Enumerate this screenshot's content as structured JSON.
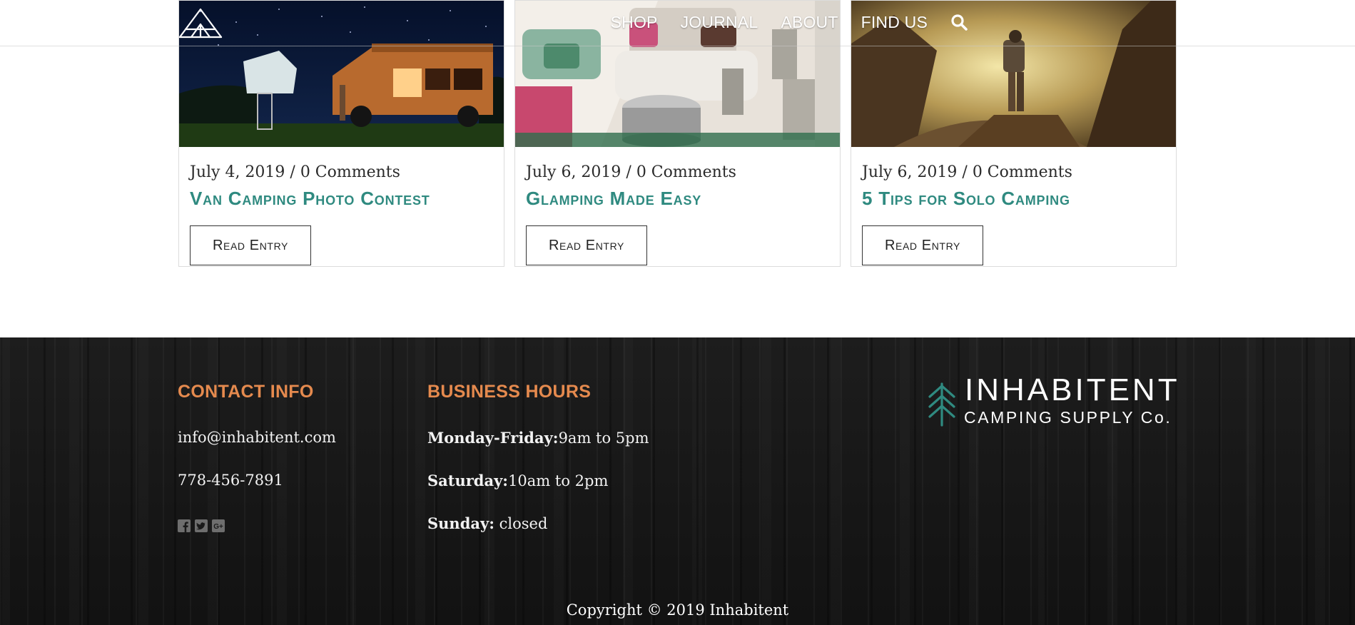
{
  "header": {
    "logo_icon": "tent-logo-icon",
    "nav": [
      "SHOP",
      "JOURNAL",
      "ABOUT",
      "FIND US"
    ],
    "search_icon": "search-icon"
  },
  "posts": [
    {
      "meta": "July 4, 2019 / 0 Comments",
      "title": "Van Camping Photo Contest",
      "button": "Read Entry",
      "image": "van-camping-night-photo"
    },
    {
      "meta": "July 6, 2019 / 0 Comments",
      "title": "Glamping Made Easy",
      "button": "Read Entry",
      "image": "glamping-tent-interior-photo"
    },
    {
      "meta": "July 6, 2019 / 0 Comments",
      "title": "5 Tips for Solo Camping",
      "button": "Read Entry",
      "image": "solo-hiker-mountains-photo"
    }
  ],
  "footer": {
    "contact": {
      "heading": "CONTACT INFO",
      "email": "info@inhabitent.com",
      "phone": "778-456-7891",
      "social_icons": [
        "facebook-icon",
        "twitter-icon",
        "google-plus-icon"
      ]
    },
    "hours": {
      "heading": "BUSINESS HOURS",
      "rows": [
        {
          "day": "Monday-Friday:",
          "time": "9am to 5pm"
        },
        {
          "day": "Saturday:",
          "time": "10am to 2pm"
        },
        {
          "day": "Sunday:",
          "time": " closed"
        }
      ]
    },
    "brand": {
      "name": "INHABITENT",
      "subtitle": "CAMPING SUPPLY Co.",
      "icon": "pine-tree-icon"
    },
    "copyright": "Copyright © 2019 Inhabitent"
  },
  "colors": {
    "accent_teal": "#2f8a80",
    "footer_heading_orange": "#e58a4e",
    "footer_bg": "#1a1a1a"
  }
}
